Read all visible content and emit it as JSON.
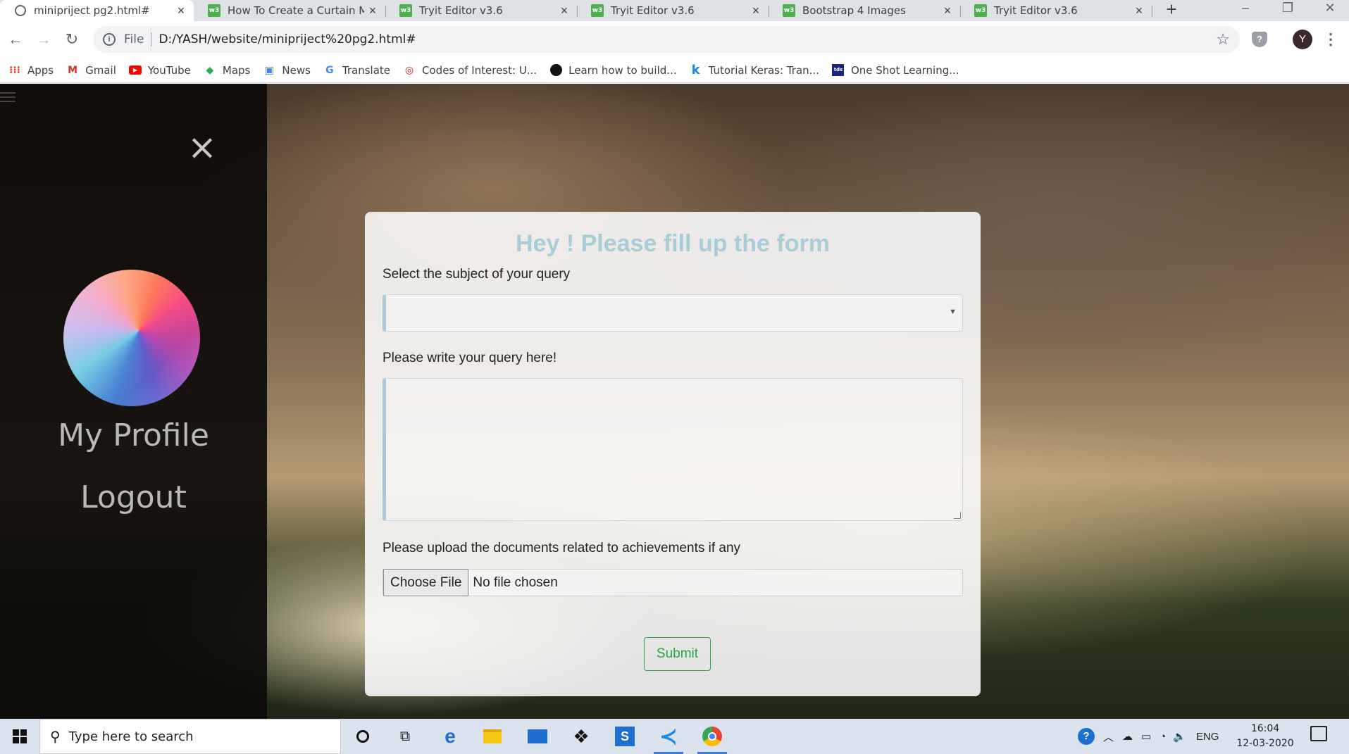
{
  "browser": {
    "tabs": [
      {
        "title": "minipriject pg2.html#",
        "icon": "globe-icon",
        "active": true
      },
      {
        "title": "How To Create a Curtain Me",
        "icon": "w3schools-icon",
        "active": false
      },
      {
        "title": "Tryit Editor v3.6",
        "icon": "w3schools-icon",
        "active": false
      },
      {
        "title": "Tryit Editor v3.6",
        "icon": "w3schools-icon",
        "active": false
      },
      {
        "title": "Bootstrap 4 Images",
        "icon": "w3schools-icon",
        "active": false
      },
      {
        "title": "Tryit Editor v3.6",
        "icon": "w3schools-icon",
        "active": false
      }
    ],
    "new_tab": "+",
    "address": {
      "scheme": "File",
      "url": "D:/YASH/website/minipriject%20pg2.html#"
    },
    "profile_initial": "Y",
    "bookmarks": [
      {
        "label": "Apps",
        "icon": "apps-grid-icon",
        "color": "#ea4335"
      },
      {
        "label": "Gmail",
        "icon": "gmail-icon",
        "color": "#d93025"
      },
      {
        "label": "YouTube",
        "icon": "youtube-icon",
        "color": "#ff0000"
      },
      {
        "label": "Maps",
        "icon": "maps-icon",
        "color": "#34a853"
      },
      {
        "label": "News",
        "icon": "news-icon",
        "color": "#4285f4"
      },
      {
        "label": "Translate",
        "icon": "translate-icon",
        "color": "#4285f4"
      },
      {
        "label": "Codes of Interest: U...",
        "icon": "codes-of-interest-icon",
        "color": "#b71c1c"
      },
      {
        "label": "Learn how to build...",
        "icon": "github-icon",
        "color": "#111111"
      },
      {
        "label": "Tutorial Keras: Tran...",
        "icon": "kaggle-icon",
        "color": "#1e88e5"
      },
      {
        "label": "One Shot Learning...",
        "icon": "tds-icon",
        "color": "#1a237e"
      }
    ]
  },
  "sidebar": {
    "close_glyph": "×",
    "links": [
      "My Profile",
      "Logout"
    ]
  },
  "form": {
    "title": "Hey ! Please fill up the form",
    "subject_label": "Select the subject of your query",
    "subject_value": "",
    "query_label": "Please write your query here!",
    "query_value": "",
    "upload_label": "Please upload the documents related to achievements if any",
    "choose_file": "Choose File",
    "file_status": "No file chosen",
    "submit": "Submit",
    "title_color": "#a8cdd9",
    "submit_color": "#28a745"
  },
  "taskbar": {
    "search_placeholder": "Type here to search",
    "apps": [
      "cortana-icon",
      "task-view-icon",
      "edge-icon",
      "file-explorer-icon",
      "mail-icon",
      "dropbox-icon",
      "sway-icon",
      "vscode-icon",
      "chrome-icon"
    ],
    "language": "ENG",
    "time": "16:04",
    "date": "12-03-2020"
  }
}
